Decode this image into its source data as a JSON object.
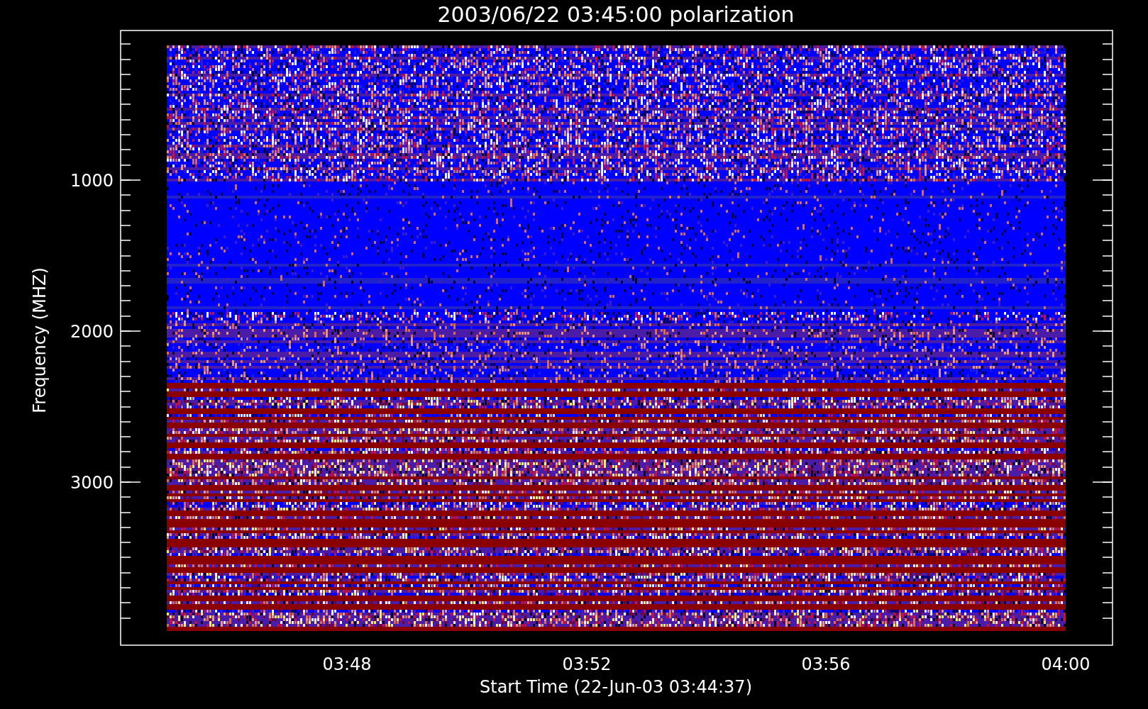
{
  "title": "2003/06/22 03:45:00 polarization",
  "y_axis": {
    "label": "Frequency (MHZ)",
    "ticks": [
      "1000",
      "2000",
      "3000"
    ]
  },
  "x_axis": {
    "label": "Start Time (22-Jun-03 03:44:37)",
    "ticks": [
      "03:48",
      "03:52",
      "03:56",
      "04:00"
    ]
  }
}
